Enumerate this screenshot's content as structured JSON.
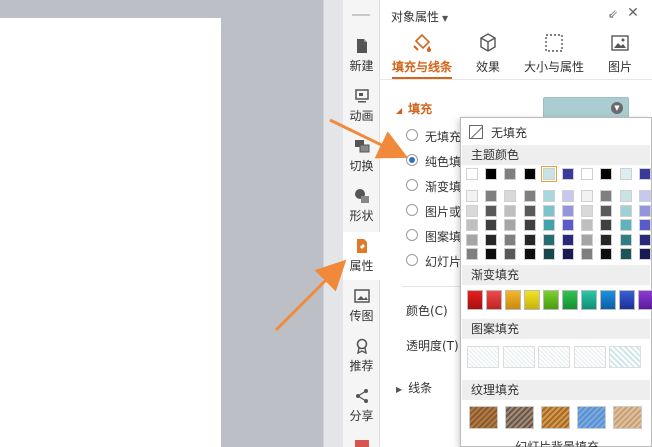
{
  "sidebar": {
    "items": [
      {
        "label": "新建",
        "icon": "new-file-icon"
      },
      {
        "label": "动画",
        "icon": "animation-icon"
      },
      {
        "label": "切换",
        "icon": "transition-icon"
      },
      {
        "label": "形状",
        "icon": "shape-icon"
      },
      {
        "label": "属性",
        "icon": "property-icon"
      },
      {
        "label": "传图",
        "icon": "upload-image-icon"
      },
      {
        "label": "推荐",
        "icon": "recommend-icon"
      },
      {
        "label": "分享",
        "icon": "share-icon"
      }
    ],
    "active": "属性"
  },
  "panel": {
    "title": "对象属性",
    "tabs": [
      {
        "label": "填充与线条",
        "icon": "fill-bucket-icon"
      },
      {
        "label": "效果",
        "icon": "cube-icon"
      },
      {
        "label": "大小与属性",
        "icon": "size-icon"
      },
      {
        "label": "图片",
        "icon": "picture-icon"
      }
    ],
    "active_tab": "填充与线条",
    "fill_section": "填充",
    "fill_options": [
      {
        "label": "无填充",
        "selected": false
      },
      {
        "label": "纯色填",
        "selected": true
      },
      {
        "label": "渐变填",
        "selected": false
      },
      {
        "label": "图片或",
        "selected": false
      },
      {
        "label": "图案填",
        "selected": false
      },
      {
        "label": "幻灯片",
        "selected": false
      }
    ],
    "color_label": "颜色(C)",
    "transparency_label": "透明度(T)",
    "line_section": "线条",
    "fill_color": "#a9cdd1"
  },
  "popup": {
    "no_fill": "无填充",
    "theme_colors_title": "主题颜色",
    "gradient_title": "渐变填充",
    "pattern_title": "图案填充",
    "texture_title": "纹理填充",
    "footer_partial": "幻灯片背景填充",
    "theme_top_row": [
      "#ffffff",
      "#000000",
      "#7f7f7f",
      "#000000",
      "#c7e3e6",
      "#3a3a9a",
      "#ffffff",
      "#000000",
      "#ddeef0",
      "#3a3a9a"
    ],
    "theme_shades": [
      [
        "#f2f2f2",
        "#7f7f7f",
        "#d9d9d9",
        "#7f7f7f",
        "#a8d8de",
        "#c8c8ee",
        "#f2f2f2",
        "#7f7f7f",
        "#c7e3e6",
        "#c8c8ee"
      ],
      [
        "#d9d9d9",
        "#595959",
        "#bfbfbf",
        "#595959",
        "#7cc3cc",
        "#9595de",
        "#d9d9d9",
        "#595959",
        "#9fd0d6",
        "#9595de"
      ],
      [
        "#bfbfbf",
        "#3f3f3f",
        "#a5a5a5",
        "#3f3f3f",
        "#3fa2ad",
        "#5a5acb",
        "#bfbfbf",
        "#3f3f3f",
        "#5fb3bd",
        "#5a5acb"
      ],
      [
        "#a5a5a5",
        "#262626",
        "#7f7f7f",
        "#262626",
        "#246b73",
        "#2a2a7a",
        "#a5a5a5",
        "#262626",
        "#2f7d86",
        "#2a2a7a"
      ],
      [
        "#7f7f7f",
        "#0d0d0d",
        "#595959",
        "#0d0d0d",
        "#17474d",
        "#1a1a52",
        "#7f7f7f",
        "#0d0d0d",
        "#1d5359",
        "#1a1a52"
      ]
    ],
    "gradients": [
      [
        "#e81e1e",
        "#a80f0f"
      ],
      [
        "#f04a4a",
        "#c02323"
      ],
      [
        "#f5b52a",
        "#c98a0c"
      ],
      [
        "#f4e227",
        "#c7b20a"
      ],
      [
        "#7bd12e",
        "#4a9a12"
      ],
      [
        "#31c351",
        "#148f30"
      ],
      [
        "#2ec6a8",
        "#0f8f77"
      ],
      [
        "#1e90e0",
        "#0c5ea8"
      ],
      [
        "#3a5fd6",
        "#1c2f9a"
      ],
      [
        "#8a3ad6",
        "#5a1a9a"
      ]
    ],
    "textures": [
      [
        "#8a5a2e",
        "#b07a44"
      ],
      [
        "#a08a78",
        "#6b5648"
      ],
      [
        "#d19a4a",
        "#a86a2a"
      ],
      [
        "#5a90d0",
        "#7aaae0"
      ],
      [
        "#c7a07a",
        "#e0c09a"
      ]
    ]
  },
  "colors": {
    "accent": "#d4641a",
    "arrow": "#f08a3a",
    "radio_selected": "#2f6fc9"
  }
}
